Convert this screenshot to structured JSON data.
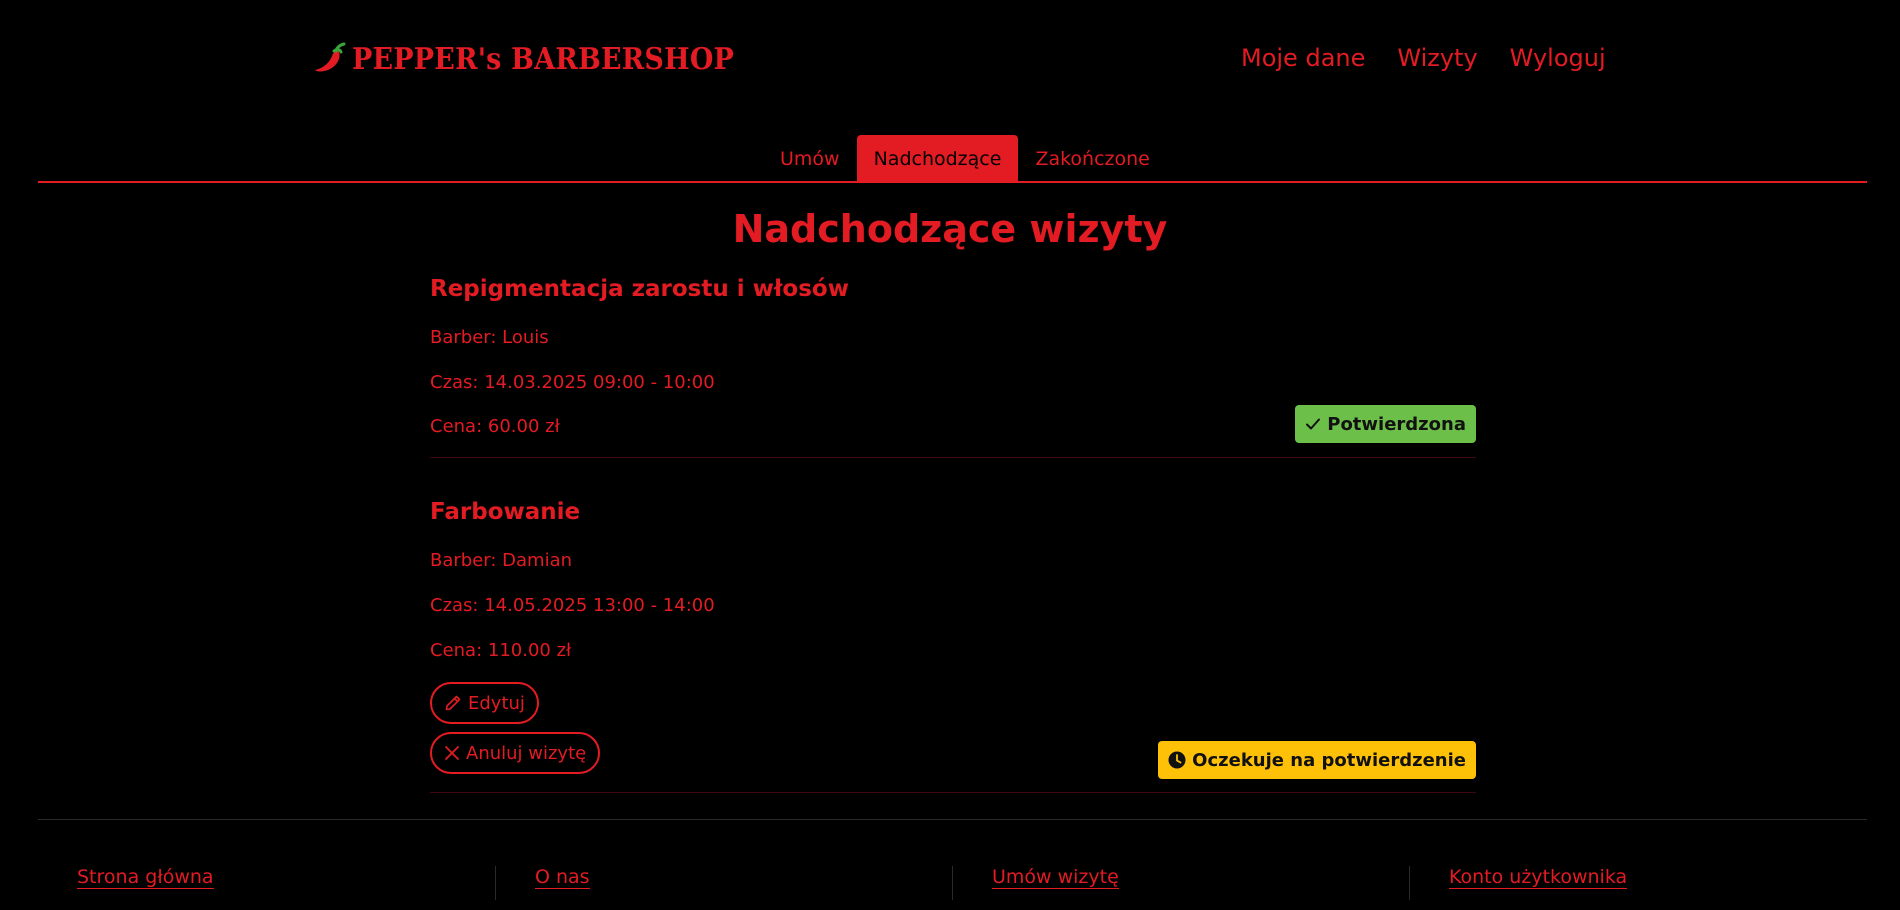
{
  "brand": {
    "name": "PEPPER's BARBERSHOP",
    "color": "#e31b23",
    "logo_icon": "chili-pepper-icon"
  },
  "nav": {
    "items": [
      "Moje dane",
      "Wizyty",
      "Wyloguj"
    ]
  },
  "tabs": {
    "items": [
      "Umów",
      "Nadchodzące",
      "Zakończone"
    ],
    "active": "Nadchodzące"
  },
  "page": {
    "title": "Nadchodzące wizyty"
  },
  "appointments": [
    {
      "service": "Repigmentacja zarostu i włosów",
      "barber": "Barber: Louis",
      "time": "Czas: 14.03.2025 09:00 - 10:00",
      "price": "Cena: 60.00 zł",
      "status": {
        "label": "Potwierdzona",
        "icon": "check-icon",
        "color": "#6cc04a"
      }
    },
    {
      "service": "Farbowanie",
      "barber": "Barber: Damian",
      "time": "Czas: 14.05.2025 13:00 - 14:00",
      "price": "Cena: 110.00 zł",
      "actions": {
        "edit": "Edytuj",
        "cancel": "Anuluj wizytę"
      },
      "status": {
        "label": "Oczekuje na potwierdzenie",
        "icon": "clock-icon",
        "color": "#ffc107"
      }
    }
  ],
  "footer": {
    "links": [
      "Strona główna",
      "O nas",
      "Umów wizytę",
      "Konto użytkownika"
    ]
  }
}
